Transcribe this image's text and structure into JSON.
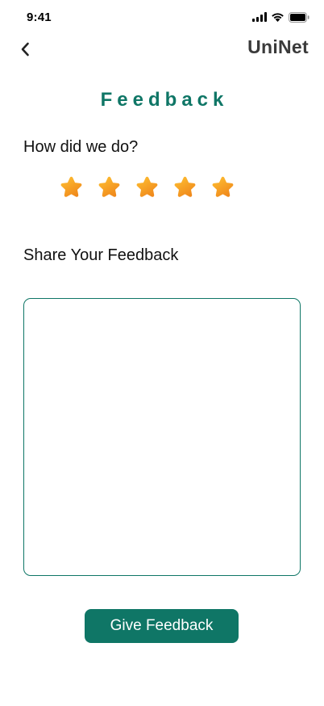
{
  "status_bar": {
    "time": "9:41",
    "icons": [
      "cellular-signal-icon",
      "wifi-icon",
      "battery-icon"
    ]
  },
  "header": {
    "back_icon": "chevron-left-icon",
    "brand": "UniNet"
  },
  "page": {
    "title": "Feedback",
    "rating_question": "How did we do?",
    "rating": {
      "value": 5,
      "max": 5
    },
    "share_label": "Share Your Feedback",
    "feedback_value": "",
    "submit_label": "Give Feedback"
  },
  "colors": {
    "accent": "#0f7666",
    "brand_text": "#3a3a3a",
    "star_light": "#ffc233",
    "star_dark": "#f08a1c"
  }
}
